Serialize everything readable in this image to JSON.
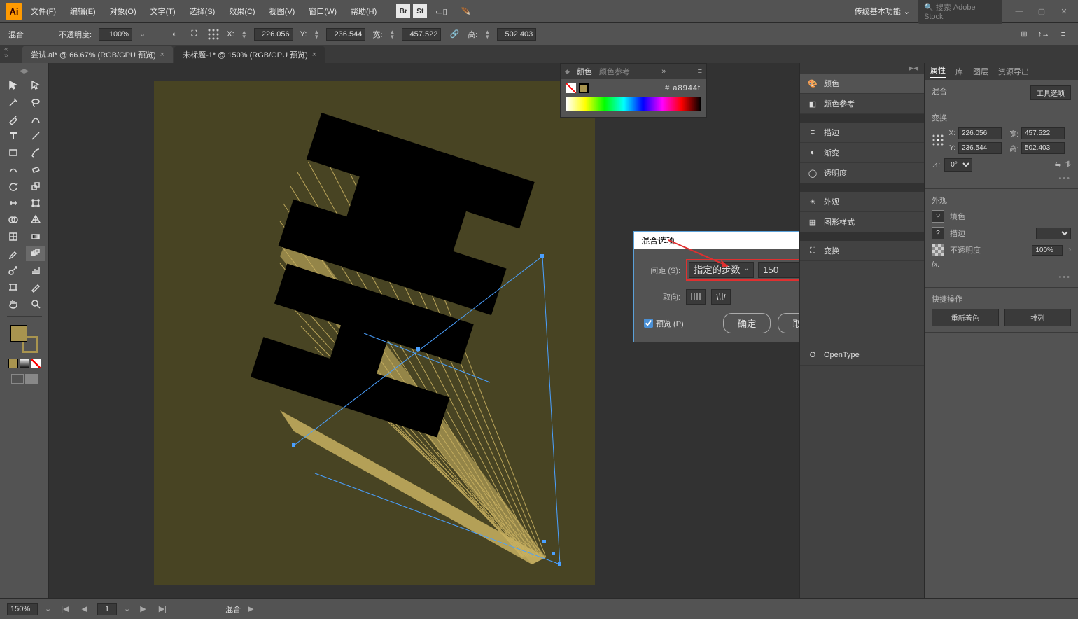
{
  "app": {
    "logo": "Ai"
  },
  "menu": [
    "文件(F)",
    "编辑(E)",
    "对象(O)",
    "文字(T)",
    "选择(S)",
    "效果(C)",
    "视图(V)",
    "窗口(W)",
    "帮助(H)"
  ],
  "menubar_right": {
    "br": "Br",
    "st": "St",
    "workspace": "传统基本功能",
    "search_placeholder": "搜索 Adobe Stock"
  },
  "controlbar": {
    "blend": "混合",
    "opacity_label": "不透明度:",
    "opacity_value": "100%",
    "x_label": "X:",
    "x": "226.056",
    "y_label": "Y:",
    "y": "236.544",
    "w_label": "宽:",
    "w": "457.522",
    "h_label": "高:",
    "h": "502.403"
  },
  "tabs": [
    {
      "label": "尝试.ai* @ 66.67% (RGB/GPU 预览)",
      "active": false
    },
    {
      "label": "未标题-1* @ 150% (RGB/GPU 预览)",
      "active": true
    }
  ],
  "color_panel": {
    "tab_color": "颜色",
    "tab_guide": "颜色参考",
    "hex_prefix": "#",
    "hex": "a8944f"
  },
  "dock_list": [
    {
      "icon": "color",
      "label": "颜色",
      "active": true
    },
    {
      "icon": "guide",
      "label": "颜色参考"
    },
    {
      "icon": "sep"
    },
    {
      "icon": "stroke",
      "label": "描边"
    },
    {
      "icon": "gradient",
      "label": "渐变"
    },
    {
      "icon": "transparency",
      "label": "透明度"
    },
    {
      "icon": "sep"
    },
    {
      "icon": "appearance",
      "label": "外观"
    },
    {
      "icon": "styles",
      "label": "图形样式"
    },
    {
      "icon": "sep"
    },
    {
      "icon": "transform",
      "label": "变换"
    },
    {
      "icon": "sep-gap"
    },
    {
      "icon": "opentype",
      "label": "OpenType"
    }
  ],
  "dialog": {
    "title": "混合选项",
    "spacing_label": "间距 (S):",
    "spacing_mode": "指定的步数",
    "spacing_value": "150",
    "orient_label": "取向:",
    "preview_label": "预览 (P)",
    "ok": "确定",
    "cancel": "取消"
  },
  "props": {
    "tabs": [
      "属性",
      "库",
      "图层",
      "资源导出"
    ],
    "blend": "混合",
    "tool_options": "工具选项",
    "transform": "变换",
    "x_label": "X:",
    "x": "226.056",
    "w_label": "宽:",
    "w": "457.522",
    "y_label": "Y:",
    "y": "236.544",
    "h_label": "高:",
    "h": "502.403",
    "angle_label": "⊿:",
    "angle": "0°",
    "appearance": "外观",
    "fill": "填色",
    "stroke": "描边",
    "opacity": "不透明度",
    "opacity_val": "100%",
    "fx": "fx.",
    "quick": "快捷操作",
    "recolor": "重新着色",
    "arrange": "排列"
  },
  "statusbar": {
    "zoom": "150%",
    "artboard": "1",
    "tool": "混合"
  }
}
